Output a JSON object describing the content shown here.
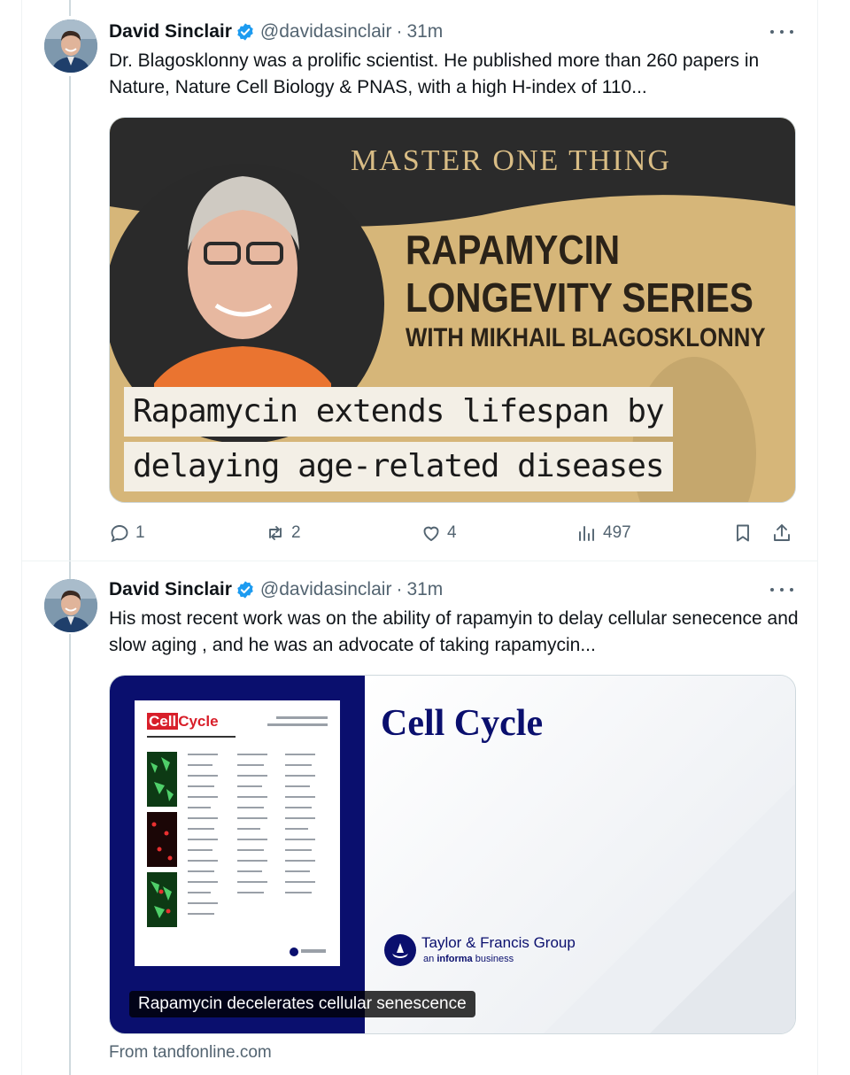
{
  "tweets": [
    {
      "author_name": "David Sinclair",
      "handle": "@davidasinclair",
      "separator": "·",
      "time": "31m",
      "text": "Dr. Blagosklonny was a prolific scientist. He published more than 260 papers in Nature, Nature Cell Biology & PNAS, with a high H-index of 110...",
      "media": {
        "banner": "MASTER ONE THING",
        "title_line1": "RAPAMYCIN",
        "title_line2": "LONGEVITY SERIES",
        "title_line3": "WITH MIKHAIL BLAGOSKLONNY",
        "overlay_line1": "Rapamycin extends lifespan by",
        "overlay_line2": "delaying age-related diseases"
      },
      "actions": {
        "replies": "1",
        "reposts": "2",
        "likes": "4",
        "views": "497"
      }
    },
    {
      "author_name": "David Sinclair",
      "handle": "@davidasinclair",
      "separator": "·",
      "time": "31m",
      "text": "His most recent work was on the ability of rapamyin to delay cellular senecence and slow aging , and he was an advocate of taking rapamycin...",
      "card": {
        "cover_brand_cell": "Cell",
        "cover_brand_cycle": "Cycle",
        "journal_title": "Cell Cycle",
        "publisher_name": "Taylor & Francis Group",
        "publisher_sub_prefix": "an",
        "publisher_sub_brand": "informa",
        "publisher_sub_suffix": "business",
        "caption": "Rapamycin decelerates cellular senescence",
        "source": "From tandfonline.com"
      }
    }
  ],
  "colors": {
    "accent_blue": "#1d9bf0",
    "text_primary": "#0f1419",
    "text_secondary": "#536471",
    "journal_navy": "#0a0f6e",
    "thumbnail_gold": "#d9b97a"
  },
  "icons": {
    "verified": "verified-badge-icon",
    "more": "more-icon",
    "reply": "reply-icon",
    "repost": "repost-icon",
    "like": "like-icon",
    "views": "views-icon",
    "bookmark": "bookmark-icon",
    "share": "share-icon"
  }
}
